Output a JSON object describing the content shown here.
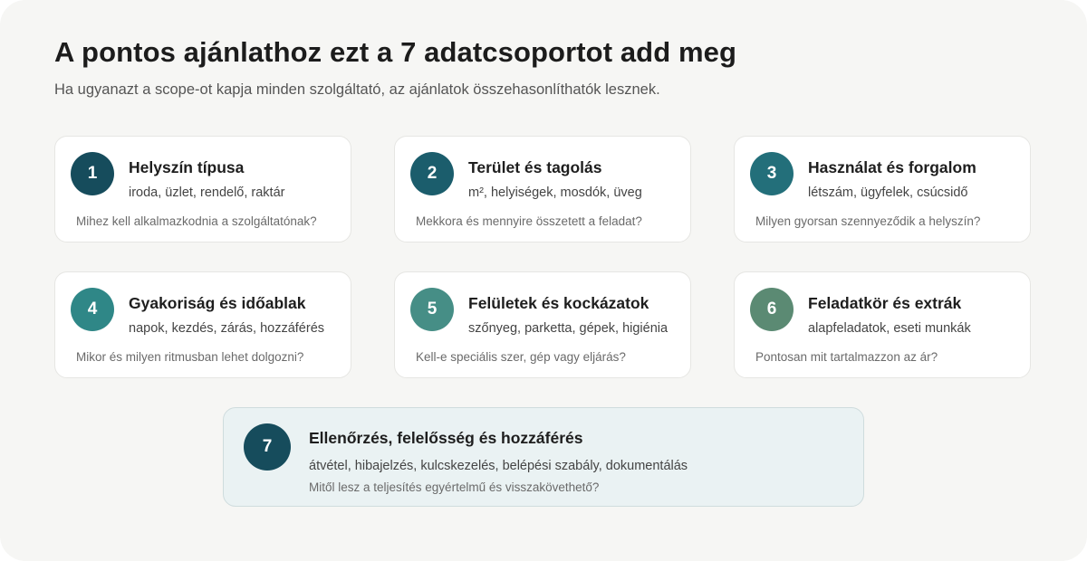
{
  "header": {
    "title": "A pontos ajánlathoz ezt a 7 adatcsoportot add meg",
    "subtitle": "Ha ugyanazt a scope-ot kapja minden szolgáltató, az ajánlatok összehasonlíthatók lesznek."
  },
  "cards": [
    {
      "number": "1",
      "title": "Helyszín típusa",
      "tags": "iroda, üzlet, rendelő, raktár",
      "question": "Mihez kell alkalmazkodnia a szolgáltatónak?",
      "color": "#164c5c"
    },
    {
      "number": "2",
      "title": "Terület és tagolás",
      "tags": "m², helyiségek, mosdók, üveg",
      "question": "Mekkora és mennyire összetett a feladat?",
      "color": "#1b5d6c"
    },
    {
      "number": "3",
      "title": "Használat és forgalom",
      "tags": "létszám, ügyfelek, csúcsidő",
      "question": "Milyen gyorsan szennyeződik a helyszín?",
      "color": "#236f7a"
    },
    {
      "number": "4",
      "title": "Gyakoriság és időablak",
      "tags": "napok, kezdés, zárás, hozzáférés",
      "question": "Mikor és milyen ritmusban lehet dolgozni?",
      "color": "#2f8787"
    },
    {
      "number": "5",
      "title": "Felületek és kockázatok",
      "tags": "szőnyeg, parketta, gépek, higiénia",
      "question": "Kell-e speciális szer, gép vagy eljárás?",
      "color": "#468e86"
    },
    {
      "number": "6",
      "title": "Feladatkör és extrák",
      "tags": "alapfeladatok, eseti munkák",
      "question": "Pontosan mit tartalmazzon az ár?",
      "color": "#5b8a73"
    },
    {
      "number": "7",
      "title": "Ellenőrzés, felelősség és hozzáférés",
      "tags": "átvétel, hibajelzés, kulcskezelés, belépési szabály, dokumentálás",
      "question": "Mitől lesz a teljesítés egyértelmű és visszakövethető?",
      "color": "#164c5c"
    }
  ]
}
